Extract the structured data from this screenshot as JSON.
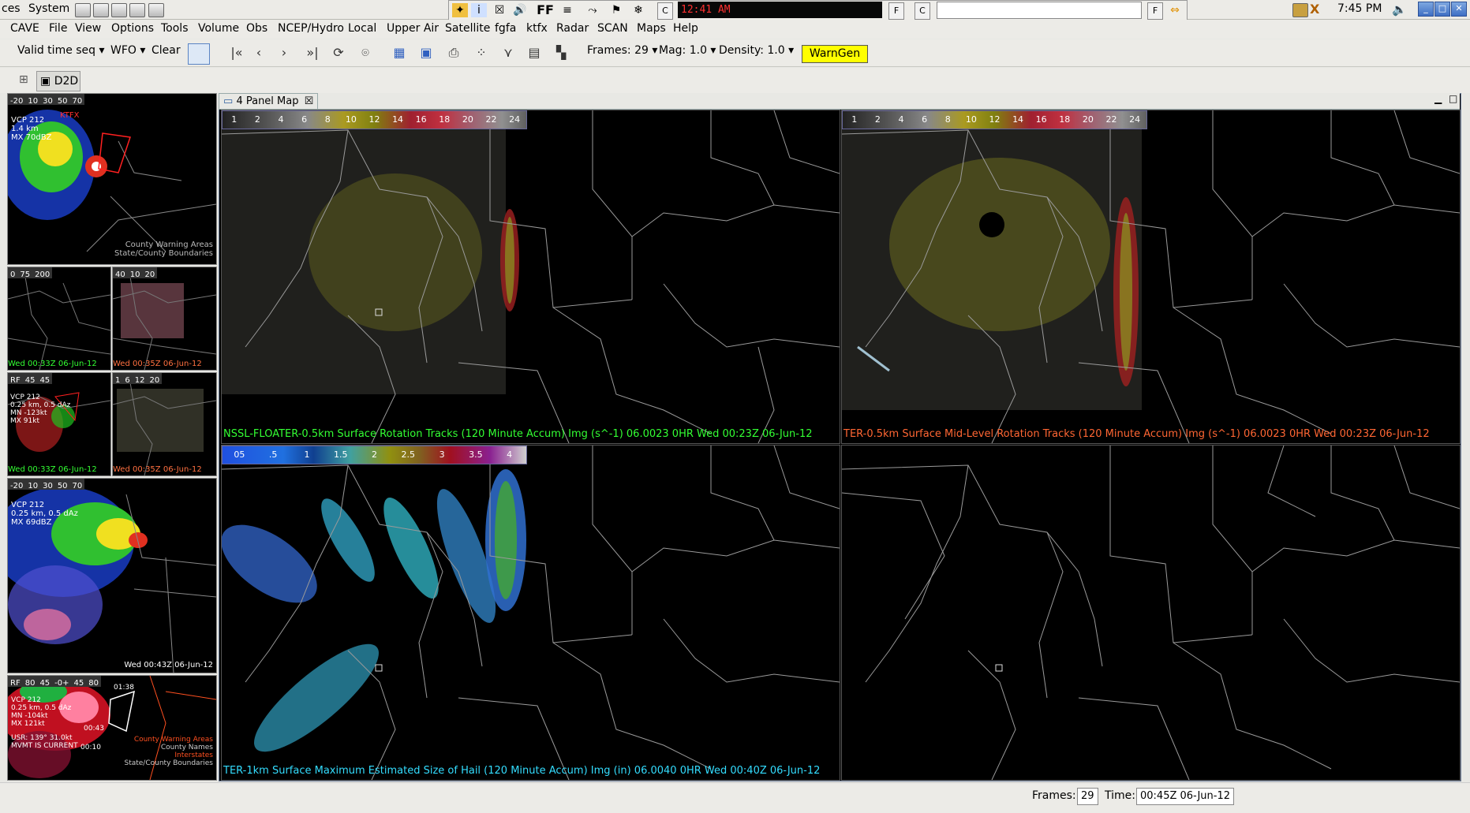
{
  "system_bar": {
    "menu_apps": "ces",
    "menu_system": "System",
    "clock_text": "12:41 AM",
    "time": "7:45 PM"
  },
  "menubar": {
    "items": [
      "CAVE",
      "File",
      "View",
      "Options",
      "Tools",
      "Volume",
      "Obs",
      "NCEP/Hydro",
      "Local",
      "Upper Air",
      "Satellite",
      "fgfa",
      "ktfx",
      "Radar",
      "SCAN",
      "Maps",
      "Help"
    ]
  },
  "toolbar": {
    "time_seq": "Valid time seq",
    "wfo": "WFO",
    "clear": "Clear",
    "frames_label": "Frames: 29",
    "mag_label": "Mag: 1.0",
    "density_label": "Density: 1.0",
    "warngen": "WarnGen",
    "perspective": "D2D"
  },
  "editor_tab": {
    "title": "4 Panel Map"
  },
  "panels": [
    {
      "colorbar": [
        "1",
        "2",
        "4",
        "6",
        "8",
        "10",
        "12",
        "14",
        "16",
        "18",
        "20",
        "22",
        "24"
      ],
      "legend": "NSSL-FLOATER-0.5km Surface Rotation Tracks (120 Minute Accum) Img (s^-1)    06.0023   0HR Wed 00:23Z 06-Jun-12",
      "legend_color": "#33ff33"
    },
    {
      "colorbar": [
        "1",
        "2",
        "4",
        "6",
        "8",
        "10",
        "12",
        "14",
        "16",
        "18",
        "20",
        "22",
        "24"
      ],
      "legend": "TER-0.5km Surface Mid-Level Rotation Tracks (120 Minute Accum) Img (s^-1)    06.0023   0HR Wed 00:23Z 06-Jun-12",
      "legend_color": "#ff6633"
    },
    {
      "colorbar": [
        "05",
        ".5",
        "1",
        "1.5",
        "2",
        "2.5",
        "3",
        "3.5",
        "4"
      ],
      "legend": "TER-1km Surface Maximum Estimated Size of Hail (120 Minute Accum) Img (in)    06.0040   0HR Wed 00:40Z 06-Jun-12",
      "legend_color": "#33ddff"
    },
    {
      "colorbar": [],
      "legend": "",
      "legend_color": "#ffffff"
    }
  ],
  "thumbnails": {
    "t1": {
      "colorbar": [
        "-20",
        "10",
        "30",
        "50",
        "70"
      ],
      "info": [
        "VCP 212",
        "1.4 km",
        "MX 70dBZ"
      ],
      "overlay1": "County Warning Areas",
      "overlay2": "State/County Boundaries",
      "warn": "KTFX"
    },
    "t2": {
      "colorbar": [
        "0",
        "75",
        "200"
      ],
      "time": "Wed 00:33Z 06-Jun-12"
    },
    "t3": {
      "colorbar": [
        "40",
        "10",
        "20"
      ],
      "time": "Wed 00:35Z 06-Jun-12"
    },
    "t4": {
      "colorbar": [
        "RF",
        "45",
        "45"
      ],
      "info": [
        "VCP 212",
        "0.25 km, 0.5 dAz",
        "MN -123kt",
        "MX 91kt"
      ],
      "time": "Wed 00:33Z 06-Jun-12"
    },
    "t5": {
      "colorbar": [
        "1",
        "6",
        "12",
        "20"
      ],
      "time": "Wed 00:35Z 06-Jun-12"
    },
    "t6": {
      "colorbar": [
        "-20",
        "10",
        "30",
        "50",
        "70"
      ],
      "info": [
        "VCP 212",
        "0.25 km, 0.5 dAz",
        "MX 69dBZ"
      ],
      "time": "Wed 00:43Z 06-Jun-12"
    },
    "t7": {
      "colorbar": [
        "RF",
        "80",
        "45",
        "-0+",
        "45",
        "80"
      ],
      "info": [
        "VCP 212",
        "0.25 km, 0.5 dAz",
        "MN -104kt",
        "MX 121kt"
      ],
      "usr": [
        "USR: 139° 31.0kt",
        "MVMT IS CURRENT"
      ],
      "time1": "00:43",
      "time2": "00:10",
      "time3": "01:38",
      "overlay1": "County Warning Areas",
      "overlay2": "County Names",
      "overlay3": "Interstates",
      "overlay4": "State/County Boundaries"
    }
  },
  "statusbar": {
    "frames_label": "Frames:",
    "frames_value": "29",
    "time_label": "Time:",
    "time_value": "00:45Z 06-Jun-12"
  }
}
